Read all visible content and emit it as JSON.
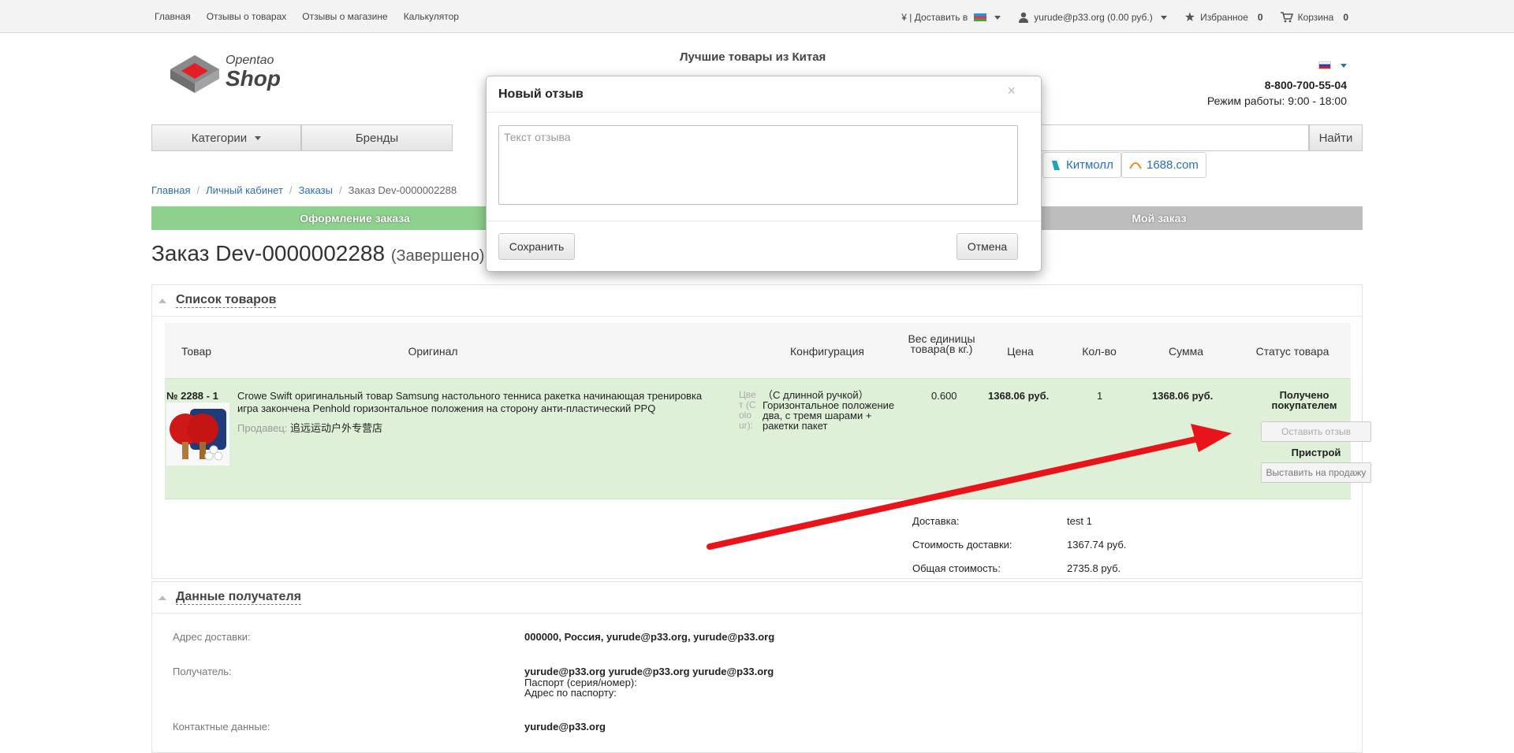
{
  "topbar": {
    "links": [
      "Главная",
      "Отзывы о товарах",
      "Отзывы о магазине",
      "Калькулятор"
    ],
    "currency_label": "¥ | Доставить в",
    "user": "yurude@p33.org (0.00 руб.)",
    "favorites_label": "Избранное",
    "favorites_count": "0",
    "cart_label": "Корзина",
    "cart_count": "0"
  },
  "header": {
    "brand_small": "Opentao",
    "brand_big": "Shop",
    "tagline": "Лучшие товары из Китая",
    "phone": "8-800-700-55-04",
    "hours": "Режим работы: 9:00 - 18:00"
  },
  "nav": {
    "categories": "Категории",
    "brands": "Бренды",
    "search_button": "Найти"
  },
  "shops": [
    "Китмолл",
    "1688.com"
  ],
  "breadcrumb": [
    "Главная",
    "Личный кабинет",
    "Заказы",
    "Заказ Dev-0000002288"
  ],
  "steps": {
    "step1": "Оформление заказа",
    "step3": "Мой заказ"
  },
  "order": {
    "title": "Заказ Dev-0000002288",
    "status": "(Завершено)"
  },
  "products": {
    "section_title": "Список товаров",
    "headers": {
      "item": "Товар",
      "original": "Оригинал",
      "config": "Конфигурация",
      "weight": "Вес единицы товара(в кг.)",
      "price": "Цена",
      "qty": "Кол-во",
      "sum": "Сумма",
      "status": "Статус товара"
    },
    "rows": [
      {
        "number": "№ 2288 - 1",
        "title": "Crowe Swift оригинальный товар Samsung настольного тенниса ракетка начинающая тренировка игра закончена Penhold горизонтальное положения на сторону анти-пластический PPQ",
        "seller_label": "Продавец:",
        "seller": "追远运动户外专营店",
        "config_label": "Цвет (Colour):",
        "config_value": "（С длинной ручкой）Горизонтальное положение два, с тремя шарами + ракетки пакет",
        "weight": "0.600",
        "price": "1368.06 руб.",
        "qty": "1",
        "sum": "1368.06 руб.",
        "status": "Получено покупателем",
        "review_button": "Оставить отзыв",
        "sub_status": "Пристрой",
        "sell_button": "Выставить на продажу"
      }
    ],
    "summary": {
      "delivery_label": "Доставка:",
      "delivery_value": "test 1",
      "cost_label": "Стоимость доставки:",
      "cost_value": "1367.74 руб.",
      "total_label": "Общая стоимость:",
      "total_value": "2735.8 руб."
    }
  },
  "recipient": {
    "section_title": "Данные получателя",
    "address_label": "Адрес доставки:",
    "address_value": "000000, Россия, yurude@p33.org, yurude@p33.org",
    "recipient_label": "Получатель:",
    "recipient_value": "yurude@p33.org yurude@p33.org yurude@p33.org",
    "passport_line": "Паспорт (серия/номер):",
    "passport_address": "Адрес по паспорту:",
    "contact_label": "Контактные данные:",
    "contact_value": "yurude@p33.org"
  },
  "modal": {
    "title": "Новый отзыв",
    "close": "×",
    "placeholder": "Текст отзыва",
    "save": "Сохранить",
    "cancel": "Отмена"
  },
  "colors": {
    "accent_green": "#8ed08e",
    "row_green": "#dff0d8",
    "arrow_red": "#e8141a"
  }
}
